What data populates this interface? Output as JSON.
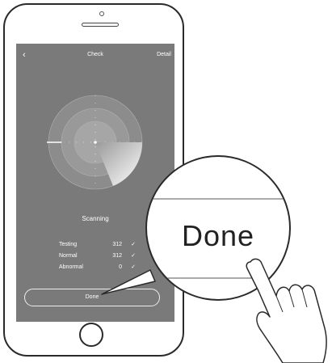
{
  "nav": {
    "back_glyph": "‹",
    "title": "Check",
    "detail": "Detail"
  },
  "scan": {
    "status": "Scanning"
  },
  "stats": [
    {
      "label": "Testing",
      "value": "312",
      "check": "✓"
    },
    {
      "label": "Normal",
      "value": "312",
      "check": "✓"
    },
    {
      "label": "Abnormal",
      "value": "0",
      "check": "✓"
    }
  ],
  "done_button": {
    "label": "Done"
  },
  "zoom": {
    "label": "Done"
  },
  "colors": {
    "screen_bg": "#7a7a7a",
    "frame": "#2a2a2a",
    "text_light": "#ffffff"
  },
  "icons": [
    "back-chevron-icon",
    "check-icon",
    "radar-icon",
    "pointing-hand-icon"
  ]
}
